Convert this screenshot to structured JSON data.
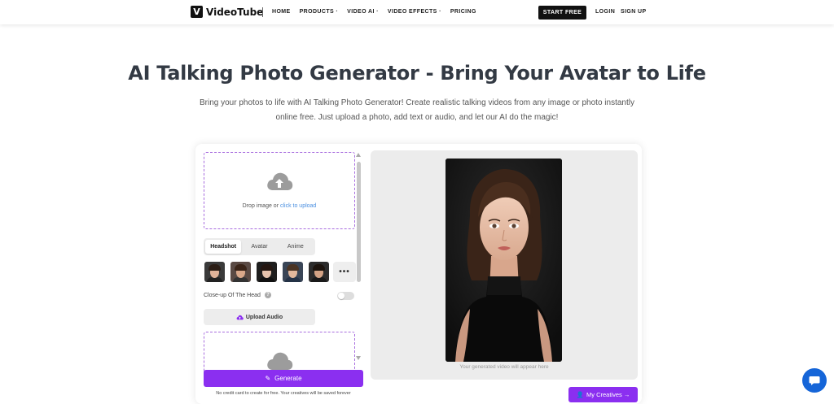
{
  "header": {
    "logo_mark": "V",
    "logo_text": "VideoTube",
    "nav": [
      "HOME",
      "PRODUCTS ·",
      "VIDEO AI ·",
      "VIDEO EFFECTS ·",
      "PRICING"
    ],
    "start_free": "START FREE",
    "login": "LOGIN",
    "signup": "SIGN UP"
  },
  "hero": {
    "title": "AI Talking Photo Generator - Bring Your Avatar to Life",
    "subtitle": "Bring your photos to life with AI Talking Photo Generator! Create realistic talking videos from any image or photo instantly online free. Just upload a photo, add text or audio, and let our AI do the magic!"
  },
  "upload": {
    "drop_text": "Drop image or ",
    "drop_link": "click to upload"
  },
  "tabs": [
    {
      "label": "Headshot",
      "active": true
    },
    {
      "label": "Avatar",
      "active": false
    },
    {
      "label": "Anime",
      "active": false
    }
  ],
  "more_label": "•••",
  "closeup": {
    "label": "Close-up Of The Head",
    "info": "?",
    "enabled": false
  },
  "upload_audio_label": "Upload Audio",
  "generate_label": "Generate",
  "no_credit_text": "No credit card to create for free. Your creatives will be saved forever",
  "preview_caption": "Your generated video will appear here",
  "my_creatives_label": "My Creatives →",
  "colors": {
    "accent": "#8b2ff0",
    "link": "#4a8fe0",
    "chat": "#1565d8"
  }
}
